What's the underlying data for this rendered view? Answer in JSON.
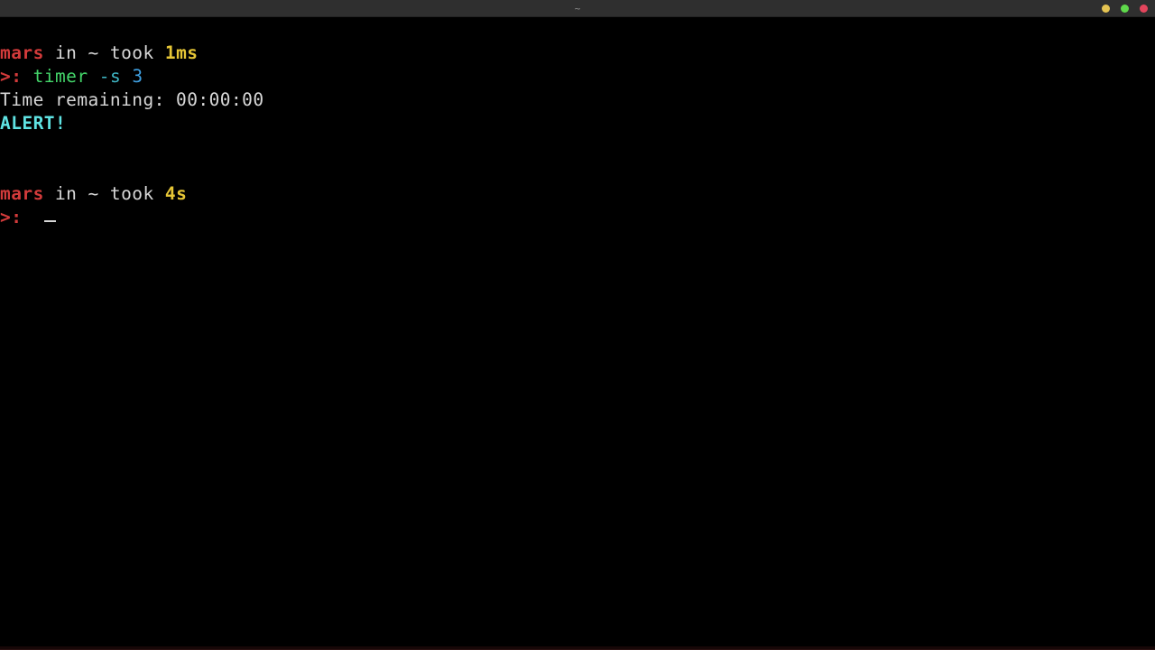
{
  "window": {
    "title": "~",
    "background_color": "#000000",
    "titlebar_color": "#2f2f2f",
    "controls": [
      {
        "name": "minimize",
        "label": "minimize",
        "color": "#e5c452"
      },
      {
        "name": "maximize",
        "label": "maximize",
        "color": "#5fd94b"
      },
      {
        "name": "close",
        "label": "close",
        "color": "#e4455c"
      }
    ]
  },
  "colors": {
    "foreground": "#d8d8d8",
    "host": "#d33b3b",
    "prompt": "#d33b3b",
    "command": "#44d66a",
    "flag": "#3fb6c4",
    "argument": "#3f9fe0",
    "duration": "#e6c636",
    "alert": "#5fe3e3"
  },
  "terminal": {
    "lines": [
      {
        "id": "prompt-header-1",
        "segments": [
          {
            "name": "host-name",
            "text": "mars",
            "color": "#d33b3b",
            "bold": true
          },
          {
            "name": "prompt-in-word",
            "text": " in ",
            "color": "#d8d8d8",
            "bold": false
          },
          {
            "name": "current-directory",
            "text": "~",
            "color": "#d8d8d8",
            "bold": false
          },
          {
            "name": "prompt-took-word",
            "text": " took ",
            "color": "#d8d8d8",
            "bold": false
          },
          {
            "name": "last-command-duration",
            "text": "1ms",
            "color": "#e6c636",
            "bold": true
          }
        ]
      },
      {
        "id": "command-line-1",
        "segments": [
          {
            "name": "prompt-symbol",
            "text": ">:",
            "color": "#d33b3b",
            "bold": true
          },
          {
            "name": "space",
            "text": " ",
            "color": "#d8d8d8",
            "bold": false
          },
          {
            "name": "command-name",
            "text": "timer",
            "color": "#44d66a",
            "bold": false
          },
          {
            "name": "space",
            "text": " ",
            "color": "#d8d8d8",
            "bold": false
          },
          {
            "name": "command-flag",
            "text": "-s",
            "color": "#3fb6c4",
            "bold": false
          },
          {
            "name": "space",
            "text": " ",
            "color": "#d8d8d8",
            "bold": false
          },
          {
            "name": "command-argument",
            "text": "3",
            "color": "#3f9fe0",
            "bold": false
          }
        ]
      },
      {
        "id": "output-time-remaining",
        "segments": [
          {
            "name": "time-remaining-output",
            "text": "Time remaining: 00:00:00",
            "color": "#d8d8d8",
            "bold": false
          }
        ]
      },
      {
        "id": "output-alert",
        "segments": [
          {
            "name": "alert-output",
            "text": "ALERT!",
            "color": "#5fe3e3",
            "bold": true
          }
        ]
      },
      {
        "id": "blank-1",
        "segments": []
      },
      {
        "id": "blank-2",
        "segments": []
      },
      {
        "id": "prompt-header-2",
        "segments": [
          {
            "name": "host-name",
            "text": "mars",
            "color": "#d33b3b",
            "bold": true
          },
          {
            "name": "prompt-in-word",
            "text": " in ",
            "color": "#d8d8d8",
            "bold": false
          },
          {
            "name": "current-directory",
            "text": "~",
            "color": "#d8d8d8",
            "bold": false
          },
          {
            "name": "prompt-took-word",
            "text": " took ",
            "color": "#d8d8d8",
            "bold": false
          },
          {
            "name": "last-command-duration",
            "text": "4s",
            "color": "#e6c636",
            "bold": true
          }
        ]
      },
      {
        "id": "command-line-2",
        "cursor": true,
        "segments": [
          {
            "name": "prompt-symbol",
            "text": ">:",
            "color": "#d33b3b",
            "bold": true
          },
          {
            "name": "input-text",
            "text": "  ",
            "color": "#d8d8d8",
            "bold": false
          }
        ]
      }
    ]
  }
}
